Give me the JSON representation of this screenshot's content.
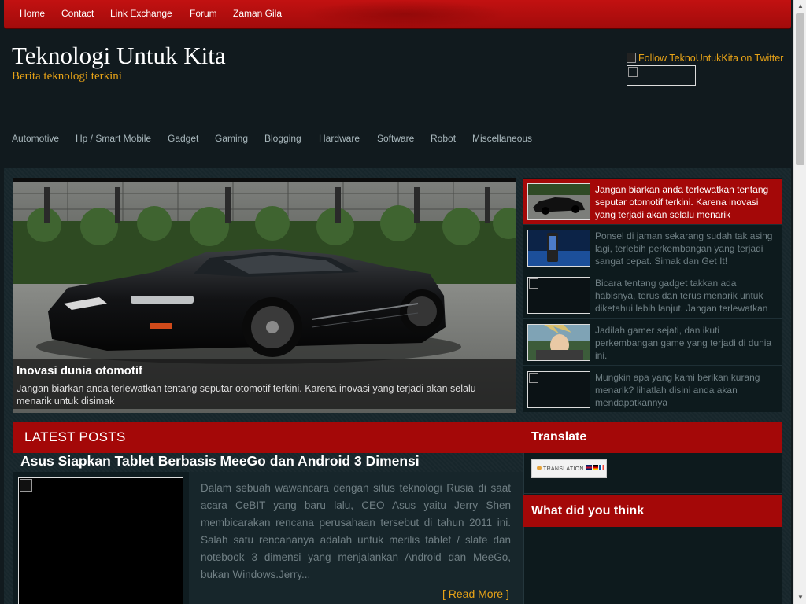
{
  "topnav": [
    "Home",
    "Contact",
    "Link Exchange",
    "Forum",
    "Zaman Gila"
  ],
  "header": {
    "title": "Teknologi Untuk Kita",
    "tagline": "Berita teknologi terkini",
    "twitter_text": "Follow TeknoUntukKita on Twitter"
  },
  "categories": [
    "Automotive",
    "Hp / Smart Mobile",
    "Gadget",
    "Gaming",
    "Blogging",
    "Hardware",
    "Software",
    "Robot",
    "Miscellaneous"
  ],
  "slider": {
    "title": "Inovasi dunia otomotif",
    "text": "Jangan biarkan anda terlewatkan tentang seputar otomotif terkini. Karena inovasi yang terjadi akan selalu menarik untuk disimak",
    "thumbs": [
      "Jangan biarkan anda terlewatkan tentang seputar otomotif terkini. Karena inovasi yang terjadi akan selalu menarik",
      "Ponsel di jaman sekarang sudah tak asing lagi, terlebih perkembangan yang terjadi sangat cepat. Simak dan Get It!",
      "Bicara tentang gadget takkan ada habisnya, terus dan terus menarik untuk diketahui lebih lanjut. Jangan terlewatkan",
      "Jadilah gamer sejati, dan ikuti perkembangan game yang terjadi di dunia ini.",
      "Mungkin apa yang kami berikan kurang menarik? lihatlah disini anda akan mendapatkannya"
    ]
  },
  "latest": {
    "heading": "LATEST POSTS",
    "post_title": "Asus Siapkan Tablet Berbasis MeeGo dan Android 3 Dimensi",
    "excerpt": "Dalam sebuah wawancara dengan situs teknologi Rusia di saat acara CeBIT yang baru lalu, CEO Asus yaitu Jerry Shen membicarakan rencana perusahaan tersebut di tahun 2011 ini. Salah satu rencananya adalah untuk merilis tablet / slate dan notebook 3 dimensi yang menjalankan Android dan MeeGo, bukan Windows.Jerry...",
    "read_more": "[ Read More ]"
  },
  "sidebar": {
    "translate_heading": "Translate",
    "translate_button": "TRANSLATION",
    "whatdid_heading": "What did you think"
  },
  "colors": {
    "accent_red": "#a40808",
    "accent_gold": "#e8a317",
    "background": "#111a1e"
  }
}
